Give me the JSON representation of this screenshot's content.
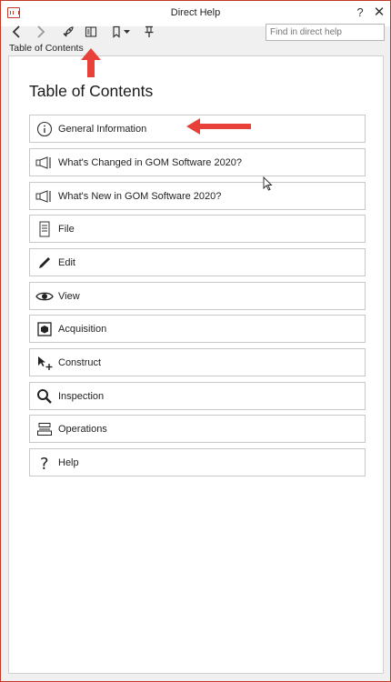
{
  "window": {
    "title": "Direct Help",
    "help_glyph": "?",
    "close_glyph": "✕"
  },
  "toolbar": {
    "buttons": [
      {
        "name": "back",
        "icon": "chevron-left-icon"
      },
      {
        "name": "forward",
        "icon": "chevron-right-icon"
      },
      {
        "name": "rocket",
        "icon": "rocket-icon"
      },
      {
        "name": "table-of-contents",
        "icon": "book-icon"
      },
      {
        "name": "bookmark",
        "icon": "bookmark-icon"
      },
      {
        "name": "pin",
        "icon": "pin-icon"
      }
    ],
    "search_placeholder": "Find in direct help"
  },
  "pane_label": "Table of Contents",
  "page": {
    "title": "Table of Contents",
    "items": [
      {
        "label": "General Information",
        "icon": "info-icon"
      },
      {
        "label": "What's Changed in GOM Software 2020?",
        "icon": "megaphone-icon"
      },
      {
        "label": "What's New in GOM Software 2020?",
        "icon": "megaphone-icon"
      },
      {
        "label": "File",
        "icon": "file-icon"
      },
      {
        "label": "Edit",
        "icon": "pencil-icon"
      },
      {
        "label": "View",
        "icon": "eye-icon"
      },
      {
        "label": "Acquisition",
        "icon": "cube-icon"
      },
      {
        "label": "Construct",
        "icon": "cursor-plus-icon"
      },
      {
        "label": "Inspection",
        "icon": "magnifier-icon"
      },
      {
        "label": "Operations",
        "icon": "stack-icon"
      },
      {
        "label": "Help",
        "icon": "question-icon"
      }
    ]
  },
  "colors": {
    "window_border": "#c0392b",
    "annotation_arrow": "#e8413a",
    "item_border": "#c8c8c8"
  }
}
